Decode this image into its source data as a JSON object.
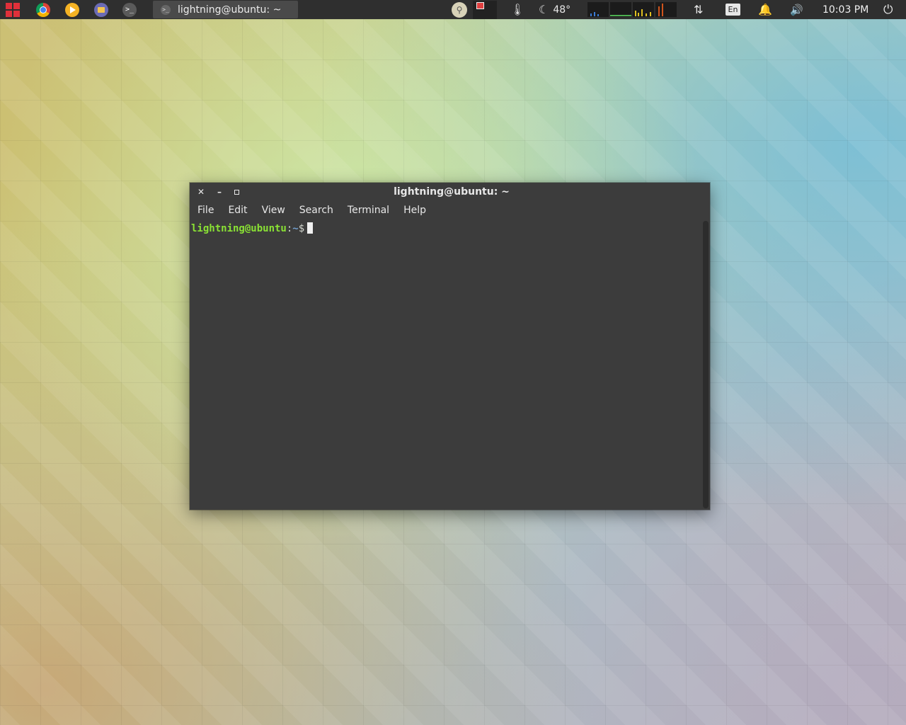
{
  "panel": {
    "launchers": [
      {
        "name": "applications-menu",
        "icon": "app-grid-icon"
      },
      {
        "name": "chrome",
        "icon": "chrome-icon"
      },
      {
        "name": "media-player",
        "icon": "play-icon"
      },
      {
        "name": "files",
        "icon": "files-icon"
      },
      {
        "name": "terminal",
        "icon": "terminal-icon",
        "glyph": ">_"
      }
    ],
    "taskbar": {
      "active_window_label": "lightning@ubuntu: ~",
      "icon_glyph": ">_"
    },
    "tray": {
      "weather_temp": "48°",
      "keyboard_layout": "En",
      "clock": "10:03 PM"
    }
  },
  "terminal": {
    "title": "lightning@ubuntu: ~",
    "menu": [
      "File",
      "Edit",
      "View",
      "Search",
      "Terminal",
      "Help"
    ],
    "prompt": {
      "user_host": "lightning@ubuntu",
      "separator": ":",
      "path": "~",
      "symbol": "$"
    }
  },
  "colors": {
    "panel_bg": "#2f2f2f",
    "terminal_bg": "#3c3c3c",
    "prompt_user": "#8ae234",
    "prompt_path": "#729fcf",
    "launcher_menu_red": "#e0303a"
  }
}
